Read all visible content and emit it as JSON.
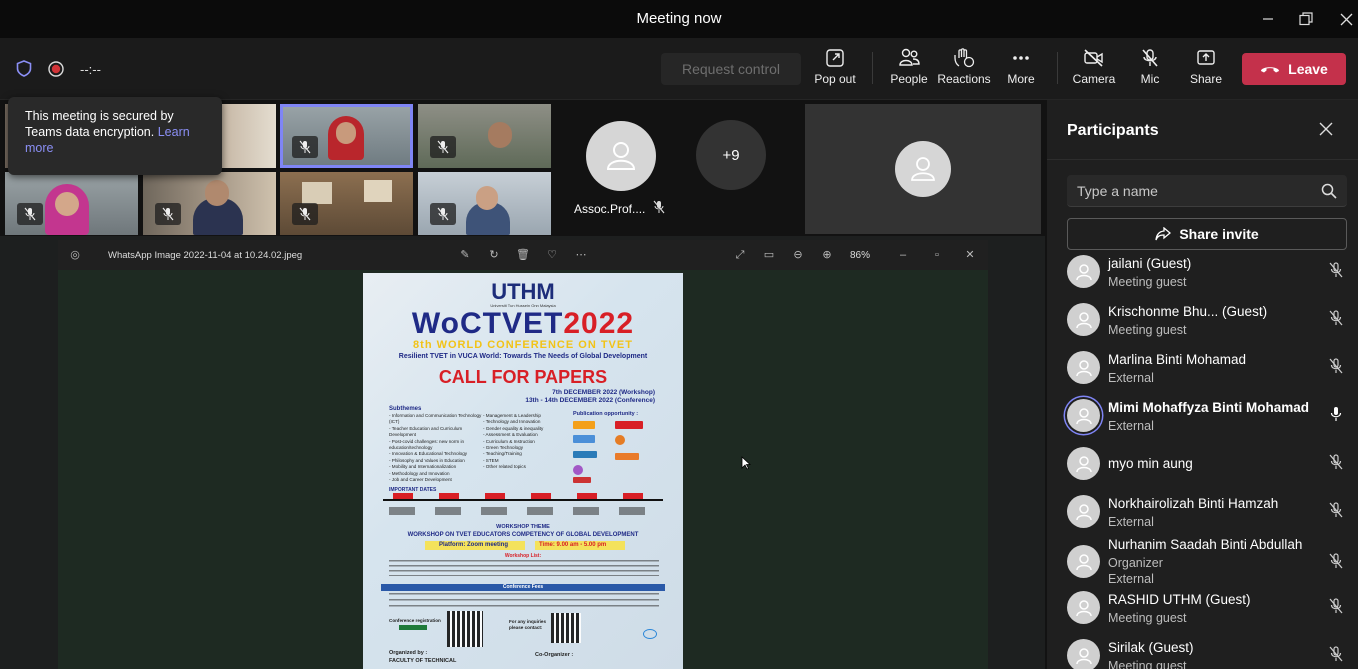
{
  "window": {
    "title": "Meeting now"
  },
  "toolbar": {
    "timer": "--:--",
    "request_control": "Request control",
    "pop_out": "Pop out",
    "people": "People",
    "reactions": "Reactions",
    "more": "More",
    "camera": "Camera",
    "mic": "Mic",
    "share": "Share",
    "leave": "Leave"
  },
  "tooltip": {
    "text": "This meeting is secured by Teams data encryption.",
    "link": "Learn more"
  },
  "stage": {
    "named_tile": "Assoc.Prof....",
    "overflow_count": "+9"
  },
  "viewer": {
    "file_name": "WhatsApp Image 2022-11-04 at 10.24.02.jpeg",
    "zoom": "86%"
  },
  "poster": {
    "logo": "UTHM",
    "logo_sub": "Universiti Tun Hussein Onn Malaysia",
    "title_a": "WoCTVET",
    "title_b": "2022",
    "conference": "8th WORLD CONFERENCE ON TVET",
    "tagline": "Resilient TVET in VUCA World: Towards The Needs of Global Development",
    "call": "CALL FOR PAPERS",
    "date_workshop": "7th DECEMBER 2022 (Workshop)",
    "date_conference": "13th - 14th DECEMBER 2022 (Conference)",
    "subthemes_header": "Subthemes",
    "subthemes_left": "- Information and Communication Technology (ICT)\n- Teacher Education and Curriculum Development\n- Post-covid challenges: new norm in education/technology\n- Innovation & Educational Technology\n- Philosophy and Values in Education\n- Mobility and Internationalization\n- Methodology and Innovation\n- Job and Career Development",
    "subthemes_right": "- Management & Leadership\n- Technology and Innovation\n- Gender equality & inequality\n- Assessment & Evaluation\n- Curriculum & Instruction\n- Green Technology\n- Teaching/Training\n- STEM\n- Other related topics",
    "publication_header": "Publication opportunity :",
    "important_dates": "IMPORTANT DATES",
    "workshop_theme": "WORKSHOP THEME",
    "workshop_title": "WORKSHOP ON TVET EDUCATORS COMPETENCY OF GLOBAL DEVELOPMENT",
    "platform": "Platform: Zoom meeting",
    "time": "Time: 9.00 am - 5.00 pm",
    "workshop_list": "Workshop List:",
    "fees": "Conference Fees",
    "registration": "Conference registration",
    "inquiries": "For any inquiries please contact:",
    "organized": "Organized by :",
    "faculty": "FACULTY OF TECHNICAL",
    "coorganizer": "Co-Organizer :"
  },
  "participants": {
    "title": "Participants",
    "search_placeholder": "Type a name",
    "share_invite": "Share invite",
    "list": [
      {
        "name": "jailani (Guest)",
        "role": "Meeting guest",
        "role2": ""
      },
      {
        "name": "Krischonme Bhu...  (Guest)",
        "role": "Meeting guest",
        "role2": ""
      },
      {
        "name": "Marlina Binti Mohamad",
        "role": "External",
        "role2": ""
      },
      {
        "name": "Mimi Mohaffyza Binti Mohamad",
        "role": "External",
        "role2": ""
      },
      {
        "name": "myo min aung",
        "role": "",
        "role2": ""
      },
      {
        "name": "Norkhairolizah Binti Hamzah",
        "role": "External",
        "role2": ""
      },
      {
        "name": "Nurhanim Saadah Binti Abdullah",
        "role": "Organizer",
        "role2": "External"
      },
      {
        "name": "RASHID UTHM (Guest)",
        "role": "Meeting guest",
        "role2": ""
      },
      {
        "name": "Sirilak (Guest)",
        "role": "Meeting guest",
        "role2": ""
      }
    ]
  },
  "colors": {
    "accent": "#7f85f5",
    "leave": "#c4314b",
    "background": "#121212"
  }
}
